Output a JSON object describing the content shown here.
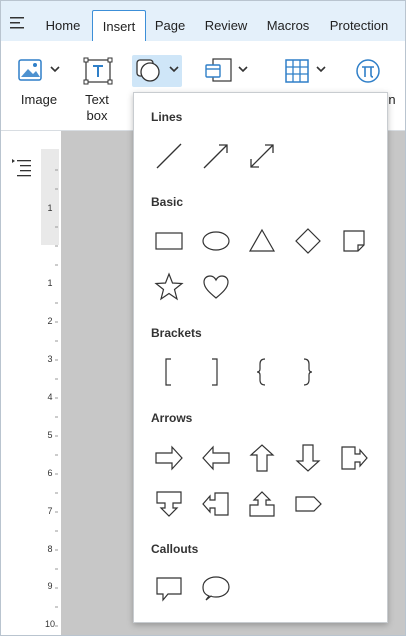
{
  "tabs": [
    {
      "label": "Home",
      "active": false
    },
    {
      "label": "Insert",
      "active": true
    },
    {
      "label": "Page",
      "active": false
    },
    {
      "label": "Review",
      "active": false
    },
    {
      "label": "Macros",
      "active": false
    },
    {
      "label": "Protection",
      "active": false
    }
  ],
  "ribbon": {
    "image_label": "Image",
    "textbox_label_line1": "Text",
    "textbox_label_line2": "box",
    "partial_label": "n"
  },
  "ruler": {
    "top_number": "1",
    "numbers": [
      "1",
      "2",
      "3",
      "4",
      "5",
      "6",
      "7",
      "8",
      "9",
      "10"
    ]
  },
  "shapes_menu": {
    "sections": [
      {
        "title": "Lines",
        "items": [
          "line-shape",
          "arrow-line-shape",
          "double-arrow-line-shape"
        ]
      },
      {
        "title": "Basic",
        "items": [
          "rectangle-shape",
          "ellipse-shape",
          "triangle-shape",
          "diamond-shape",
          "folded-corner-shape",
          "star-shape",
          "heart-shape"
        ]
      },
      {
        "title": "Brackets",
        "items": [
          "left-bracket-shape",
          "right-bracket-shape",
          "left-brace-shape",
          "right-brace-shape"
        ]
      },
      {
        "title": "Arrows",
        "items": [
          "right-arrow-shape",
          "left-arrow-shape",
          "up-arrow-shape",
          "down-arrow-shape",
          "right-arrow-callout-shape",
          "down-arrow-callout-shape",
          "left-arrow-callout-shape",
          "up-arrow-callout-shape",
          "pentagon-arrow-shape"
        ]
      },
      {
        "title": "Callouts",
        "items": [
          "rectangular-callout-shape",
          "oval-callout-shape"
        ]
      }
    ]
  },
  "colors": {
    "accent": "#2f7fc8",
    "tabbar_bg": "#e4f0fa",
    "selected_button_bg": "#cfe6f8",
    "document_bg": "#c7c7c7"
  }
}
